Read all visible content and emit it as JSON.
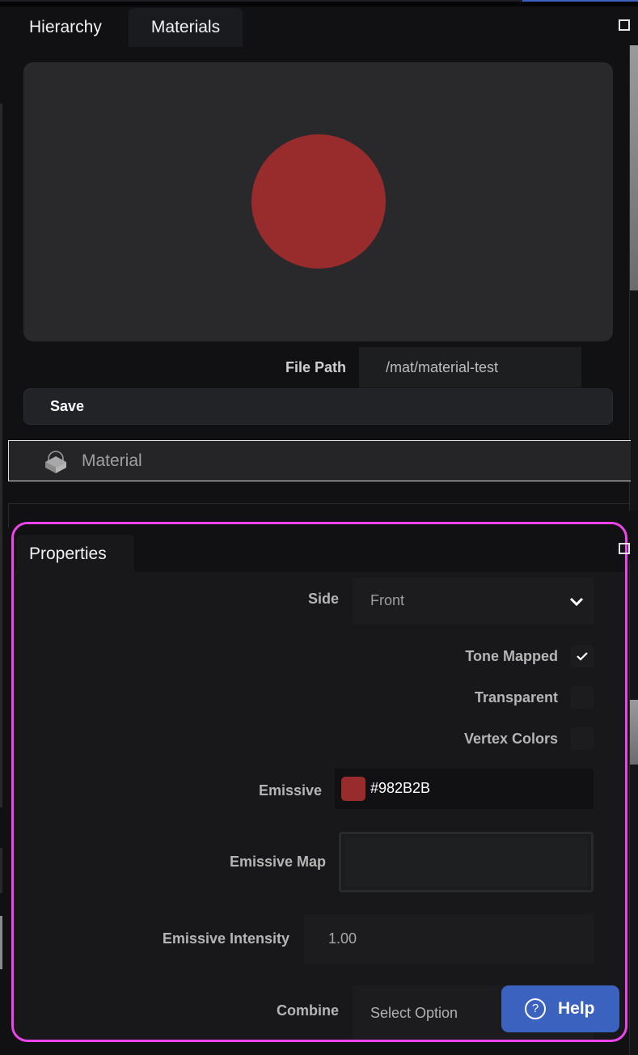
{
  "tabs": {
    "items": [
      {
        "label": "Hierarchy",
        "active": false
      },
      {
        "label": "Materials",
        "active": true
      }
    ]
  },
  "preview": {
    "sphere_color": "#982B2B"
  },
  "file_path": {
    "label": "File Path",
    "value": "/mat/material-test"
  },
  "save": {
    "label": "Save"
  },
  "material_row": {
    "label": "Material",
    "icon": "material-icon"
  },
  "properties": {
    "tab_label": "Properties",
    "side": {
      "label": "Side",
      "value": "Front"
    },
    "tone_mapped": {
      "label": "Tone Mapped",
      "checked": true
    },
    "transparent": {
      "label": "Transparent",
      "checked": false
    },
    "vertex_colors": {
      "label": "Vertex Colors",
      "checked": false
    },
    "emissive": {
      "label": "Emissive",
      "value": "#982B2B",
      "color": "#982B2B"
    },
    "emissive_map": {
      "label": "Emissive Map"
    },
    "emissive_intensity": {
      "label": "Emissive Intensity",
      "value": "1.00"
    },
    "combine": {
      "label": "Combine",
      "value": "Select Option"
    }
  },
  "help": {
    "label": "Help",
    "icon": "?"
  },
  "colors": {
    "highlight": "#EE44EE",
    "accent": "#3C62BF"
  }
}
